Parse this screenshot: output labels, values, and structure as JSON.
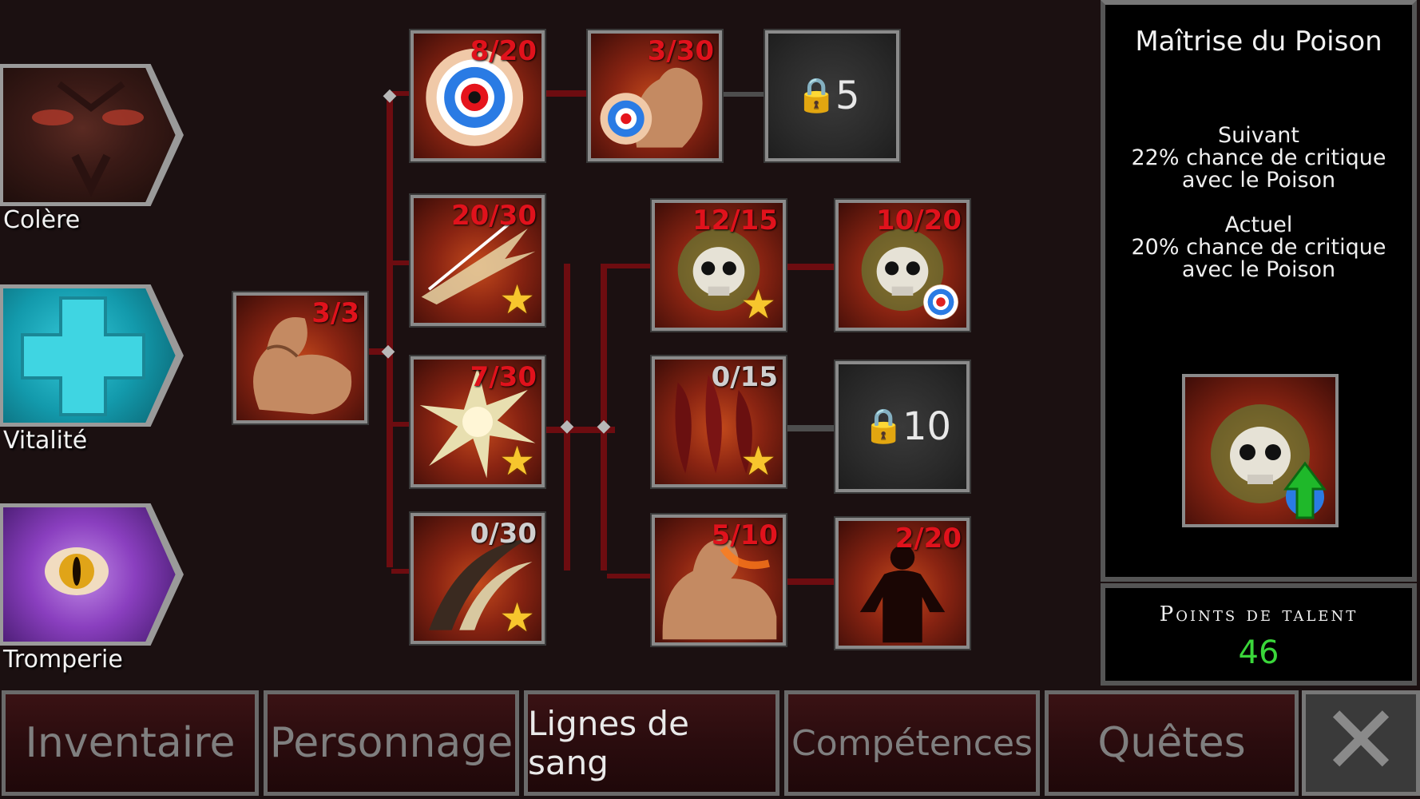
{
  "categories": [
    {
      "label": "Colère",
      "color": "#3a1c18"
    },
    {
      "label": "Vitalité",
      "color": "#1da6b8"
    },
    {
      "label": "Tromperie",
      "color": "#8a3fbf"
    }
  ],
  "talents": {
    "t_target": "8/20",
    "t_arm_target": "3/30",
    "t_locked_5": "5",
    "t_strike": "20/30",
    "t_arm_root": "3/3",
    "t_burst": "7/30",
    "t_claw": "0/30",
    "t_poison": "12/15",
    "t_poison_crit": "10/20",
    "t_blood": "0/15",
    "t_locked_10": "10",
    "t_fire_arm": "5/10",
    "t_flame_man": "2/20"
  },
  "info_panel": {
    "title": "Maîtrise du Poison",
    "next_label": "Suivant",
    "next_line1": "22% chance de critique",
    "next_line2": "avec le Poison",
    "current_label": "Actuel",
    "current_line1": "20% chance de critique",
    "current_line2": "avec le Poison"
  },
  "points": {
    "label": "Points de talent",
    "value": "46"
  },
  "tabs": {
    "inventory": "Inventaire",
    "character": "Personnage",
    "bloodlines": "Lignes de sang",
    "skills": "Compétences",
    "quests": "Quêtes"
  },
  "icons": {
    "close": "close-icon",
    "star": "star-icon",
    "lock": "lock-icon",
    "upgrade": "upgrade-arrow-icon"
  },
  "colors": {
    "counter_red": "#e0121c",
    "points_green": "#3ad63a",
    "star": "#f7c62d"
  }
}
